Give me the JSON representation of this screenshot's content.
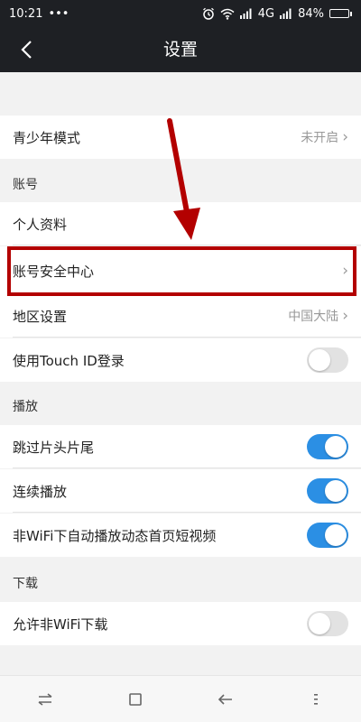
{
  "status_bar": {
    "time": "10:21",
    "dots": "•••",
    "network": "4G",
    "battery": "84%",
    "battery_level": 0.84
  },
  "header": {
    "title": "设置"
  },
  "rows": {
    "youth_mode": {
      "label": "青少年模式",
      "value": "未开启"
    },
    "profile": {
      "label": "个人资料"
    },
    "security_center": {
      "label": "账号安全中心"
    },
    "region": {
      "label": "地区设置",
      "value": "中国大陆"
    },
    "touch_id": {
      "label": "使用Touch ID登录",
      "enabled": false
    },
    "skip_intro": {
      "label": "跳过片头片尾",
      "enabled": true
    },
    "autoplay_next": {
      "label": "连续播放",
      "enabled": true
    },
    "non_wifi_autoplay": {
      "label": "非WiFi下自动播放动态首页短视频",
      "enabled": true
    },
    "non_wifi_download": {
      "label": "允许非WiFi下载",
      "enabled": false
    }
  },
  "sections": {
    "account": "账号",
    "playback": "播放",
    "download": "下载"
  },
  "colors": {
    "header_bg": "#1e2024",
    "toggle_on": "#2b8fe4",
    "annotation": "#b30000"
  }
}
